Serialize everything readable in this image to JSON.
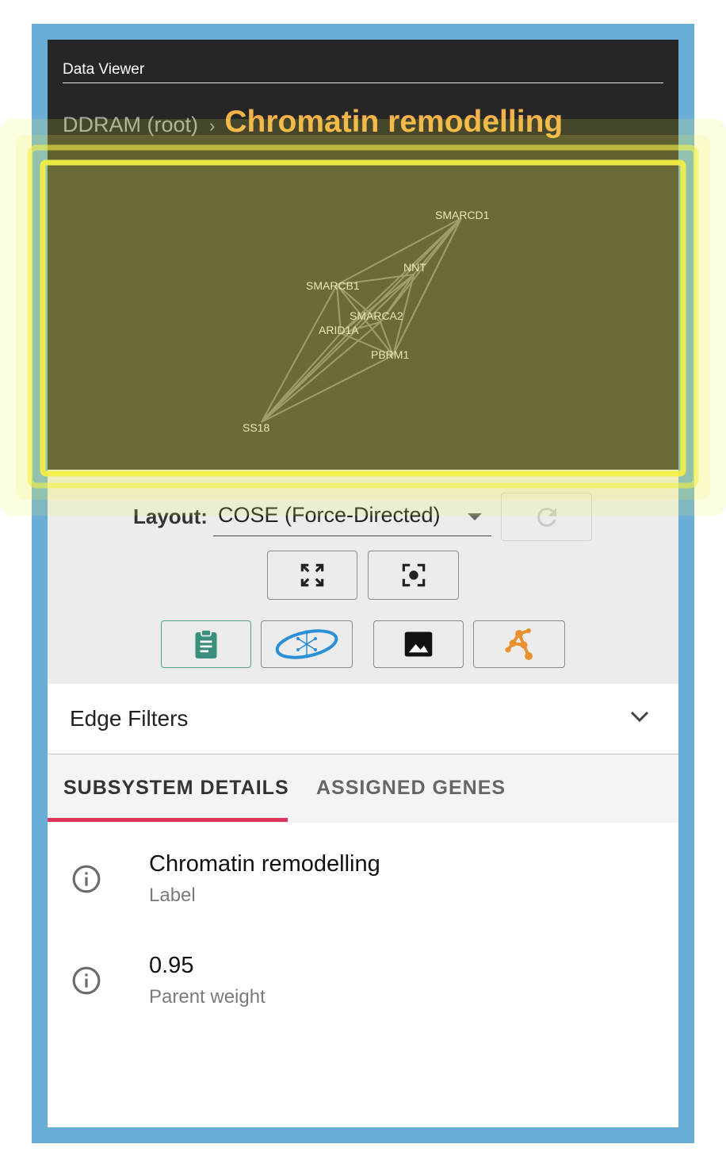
{
  "window": {
    "title": "Data Viewer"
  },
  "breadcrumb": {
    "root": "DDRAM (root)",
    "separator": "›",
    "current": "Chromatin remodelling"
  },
  "network": {
    "nodes": [
      "SMARCD1",
      "NNT",
      "SMARCB1",
      "SMARCA2",
      "ARID1A",
      "PBRM1",
      "SS18"
    ]
  },
  "layout": {
    "label": "Layout:",
    "selected": "COSE (Force-Directed)"
  },
  "toolbar": {
    "refresh_icon": "refresh-icon",
    "fit_icon": "fit-screen-icon",
    "center_icon": "center-focus-icon",
    "clipboard_icon": "clipboard-icon",
    "ontology_icon": "ontology-icon",
    "image_icon": "image-icon",
    "cytoscape_icon": "cytoscape-icon"
  },
  "edge_filters": {
    "label": "Edge Filters"
  },
  "tabs": [
    {
      "label": "SUBSYSTEM DETAILS",
      "active": true
    },
    {
      "label": "ASSIGNED GENES",
      "active": false
    }
  ],
  "details": [
    {
      "value": "Chromatin remodelling",
      "label": "Label"
    },
    {
      "value": "0.95",
      "label": "Parent weight"
    }
  ],
  "colors": {
    "accent": "#f3b14a",
    "tab_indicator": "#e0355d",
    "frame": "#6aaed8",
    "highlight": "#f5f04a",
    "clipboard": "#3a8f7d",
    "ontology": "#2a8fd6",
    "cytoscape": "#e8912e"
  }
}
